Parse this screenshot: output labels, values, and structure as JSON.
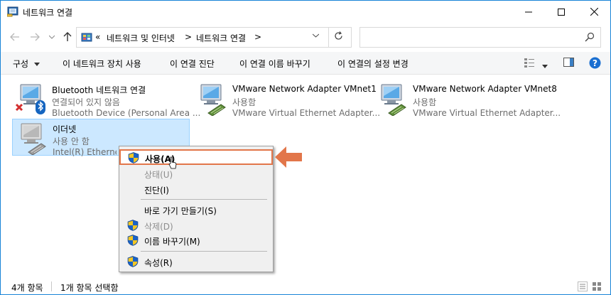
{
  "window": {
    "title": "네트워크 연결"
  },
  "nav": {
    "crumbs": [
      "«",
      "네트워크 및 인터넷",
      ">",
      "네트워크 연결",
      ">"
    ],
    "search_placeholder": ""
  },
  "commands": {
    "organize": "구성",
    "disable": "이 네트워크 장치 사용",
    "diagnose": "이 연결 진단",
    "rename": "이 연결 이름 바꾸기",
    "settings": "이 연결의 설정 변경"
  },
  "connections": [
    {
      "name": "Bluetooth 네트워크 연결",
      "status": "연결되어 있지 않음",
      "device": "Bluetooth Device (Personal Area ...",
      "icon": "bluetooth-network-icon"
    },
    {
      "name": "VMware Network Adapter VMnet1",
      "status": "사용함",
      "device": "VMware Virtual Ethernet Adapter...",
      "icon": "network-adapter-icon"
    },
    {
      "name": "VMware Network Adapter VMnet8",
      "status": "사용함",
      "device": "VMware Virtual Ethernet Adapter...",
      "icon": "network-adapter-icon"
    },
    {
      "name": "이더넷",
      "status": "사용 안 함",
      "device": "Intel(R) Ethernet C",
      "icon": "disabled-network-icon"
    }
  ],
  "context_menu": {
    "enable": "사용(A)",
    "status": "상태(U)",
    "diagnose": "진단(I)",
    "shortcut": "바로 가기 만들기(S)",
    "delete": "삭제(D)",
    "rename": "이름 바꾸기(M)",
    "properties": "속성(R)"
  },
  "statusbar": {
    "count": "4개 항목",
    "selected": "1개 항목 선택함"
  },
  "colors": {
    "accent": "#1883d7",
    "selection": "#cce8ff",
    "highlight_arrow": "#e2764a"
  }
}
